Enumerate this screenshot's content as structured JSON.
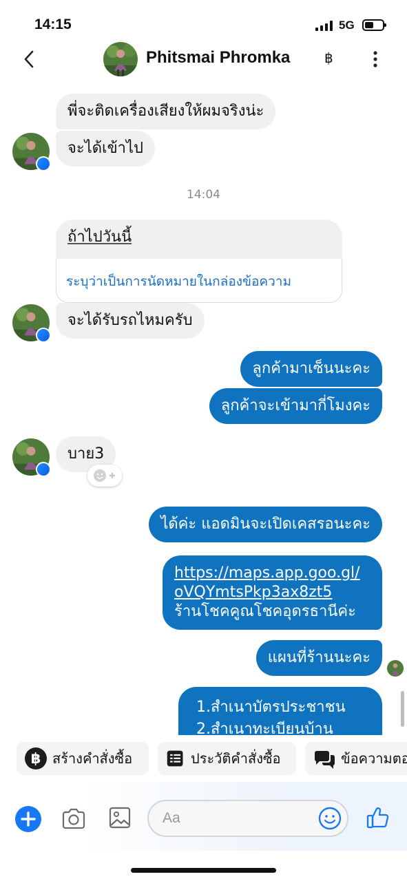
{
  "status_bar": {
    "time": "14:15",
    "network": "5G"
  },
  "header": {
    "contact_name": "Phitsmai Phromka",
    "currency_symbol": "฿"
  },
  "messages": [
    {
      "text": "พี่จะติดเครื่องเสียงให้ผมจริงน่ะ"
    },
    {
      "text": "จะได้เข้าไป"
    },
    {
      "timestamp": "14:04"
    },
    {
      "text": "ถ้าไปวันนี้",
      "link_card": "ระบุว่าเป็นการนัดหมายในกล่องข้อความ"
    },
    {
      "text": "จะได้รับรถไหมครับ"
    },
    {
      "text": "ลูกค้ามาเซ็นนะคะ"
    },
    {
      "text": "ลูกค้าจะเข้ามากี่โมงคะ"
    },
    {
      "text": "บาย3"
    },
    {
      "text": "ได้ค่ะ แอดมินจะเปิดเคสรอนะคะ"
    },
    {
      "link_line1": "https://maps.app.goo.gl/",
      "link_line2": "oVQYmtsPkp3ax8zt5",
      "text": "ร้านโชคคูณโชคอุดรธานีค่ะ"
    },
    {
      "text": "แผนที่ร้านนะคะ"
    },
    {
      "line1": "1.สำเนาบัตรประชาชน",
      "line2": "2.สำเนาทะเบียนบ้าน"
    }
  ],
  "quick_actions": [
    {
      "label": "สร้างคำสั่งซื้อ",
      "icon": "baht-icon"
    },
    {
      "label": "ประวัติคำสั่งซื้อ",
      "icon": "list-icon"
    },
    {
      "label": "ข้อความตอ",
      "icon": "chat-bubbles-icon"
    }
  ],
  "composer": {
    "placeholder": "Aa"
  },
  "colors": {
    "accent": "#1877f2",
    "outgoing_bubble": "#0f73bf",
    "incoming_bubble": "#f0f0f0",
    "link": "#1a6fc7"
  }
}
